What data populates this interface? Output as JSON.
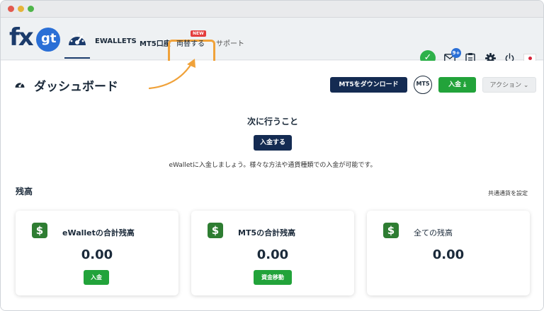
{
  "navbar": {
    "logo_fx": "fx",
    "logo_gt": "gt",
    "ewallets": "EWALLETS",
    "mt5_account": "MT5口座",
    "exchange": "両替する",
    "new_badge": "NEW",
    "support": "サポート",
    "mail_count": "9+"
  },
  "header": {
    "title": "ダッシュボード",
    "download_button": "MT5をダウンロード",
    "mt5_badge": "MT5",
    "deposit_button": "入金 ⤓",
    "action_button": "アクション ⌄"
  },
  "next_steps": {
    "title": "次に行うこと",
    "button": "入金する",
    "description": "eWalletに入金しましょう。様々な方法や通貨種類での入金が可能です。"
  },
  "balance": {
    "title": "残高",
    "currency_link": "共通通貨を設定",
    "cards": [
      {
        "label": "eWalletの合計残高",
        "value": "0.00",
        "button": "入金"
      },
      {
        "label": "MT5の合計残高",
        "value": "0.00",
        "button": "資金移動"
      },
      {
        "label": "全ての残高",
        "value": "0.00"
      }
    ]
  },
  "colors": {
    "navy": "#142b52",
    "green": "#22a33a",
    "highlight": "#f0a23a",
    "new_badge": "#e43d3d"
  }
}
